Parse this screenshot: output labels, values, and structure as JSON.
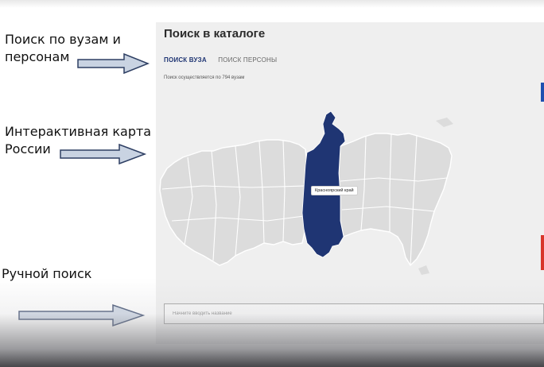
{
  "annotations": {
    "search_tabs": "Поиск по вузам и персонам",
    "map": "Интерактивная карта России",
    "manual": "Ручной поиск"
  },
  "catalog": {
    "title": "Поиск в каталоге",
    "tabs": [
      {
        "label": "ПОИСК ВУЗА",
        "active": true
      },
      {
        "label": "ПОИСК ПЕРСОНЫ",
        "active": false
      }
    ],
    "search_info": "Поиск осуществляется по 794 вузам",
    "map": {
      "highlighted_region": "Красноярский край",
      "highlight_color": "#1f3573",
      "region_color": "#dcdcdc"
    },
    "manual_search": {
      "placeholder": "Начните вводить название"
    }
  },
  "colors": {
    "accent": "#1f3573",
    "panel_bg": "#efefef"
  }
}
